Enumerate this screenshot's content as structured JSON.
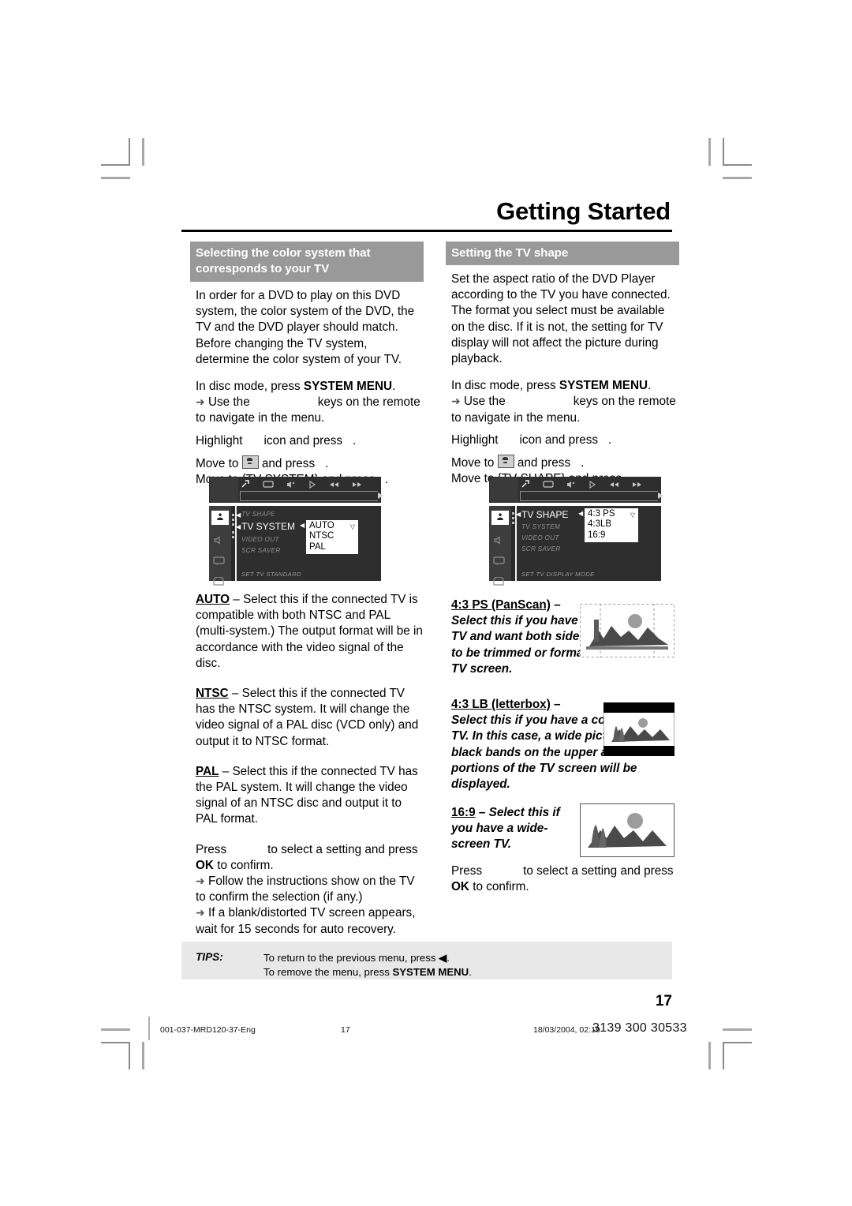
{
  "header": {
    "title": "Getting Started"
  },
  "left_column": {
    "section_title": "Selecting the color system that corresponds to your TV",
    "intro": "In order for a DVD to play on this DVD system, the color system of the DVD, the TV and the DVD player should match. Before changing the TV system, determine the color system of your TV.",
    "step_press_pre": "In disc mode, press ",
    "step_press_bold": "SYSTEM MENU",
    "step_press_post": ".",
    "use_keys_pre": "Use the",
    "use_keys_post": "keys on the remote to navigate in the menu.",
    "highlight_pre": "Highlight",
    "highlight_mid": "icon and press",
    "highlight_post": ".",
    "move_to_icon_pre": "Move to",
    "move_to_icon_post": "and press",
    "move_to_icon_end": ".",
    "move_to_menu": "Move to {TV SYSTEM} and press",
    "move_to_menu_end": ".",
    "options": [
      {
        "name": "AUTO",
        "text": " – Select this if the connected TV is compatible with both NTSC and PAL (multi-system.)  The output format will be in accordance with the video signal of the disc."
      },
      {
        "name": "NTSC",
        "text": " – Select this if the connected TV has the NTSC system. It will change the video signal of a PAL disc (VCD only) and output it to NTSC format."
      },
      {
        "name": "PAL",
        "text": " – Select this if the connected TV has the PAL system. It will change the video signal of an NTSC disc and output it to PAL format."
      }
    ],
    "press_pre": "Press",
    "press_mid": "to select a setting and press",
    "press_ok": "OK",
    "press_post": " to confirm.",
    "note1": "Follow the instructions show on the TV to confirm the selection (if any.)",
    "note2": "If a blank/distorted TV screen appears, wait for 15 seconds for auto recovery."
  },
  "right_column": {
    "section_title": "Setting the TV shape",
    "intro": "Set the aspect ratio of the DVD Player according to the TV you have connected. The format you select must be available on the disc.  If it is not, the setting for TV display will not affect the picture during playback.",
    "step_press_pre": "In disc mode, press ",
    "step_press_bold": "SYSTEM MENU",
    "step_press_post": ".",
    "use_keys_pre": "Use the",
    "use_keys_post": "keys on the remote to navigate in the menu.",
    "highlight_pre": "Highlight",
    "highlight_mid": "icon and press",
    "highlight_post": ".",
    "move_to_icon_pre": "Move to",
    "move_to_icon_post": "and press",
    "move_to_icon_end": ".",
    "move_to_menu": "Move to {TV SHAPE} and press",
    "move_to_menu_end": ".",
    "shapes": [
      {
        "name": "4:3 PS (PanScan)",
        "dash": " – ",
        "desc": "Select this if you have a conventional TV and want both sides of the picture to be trimmed or formatted to fit your TV screen."
      },
      {
        "name": "4:3 LB (letterbox)",
        "dash": " – ",
        "desc": "Select this if you have a conventional TV. In this case, a wide picture with black bands on the upper and lower portions of the TV screen will be displayed."
      },
      {
        "name": "16:9",
        "dash": " – ",
        "desc": "Select this if you have a wide-screen TV."
      }
    ],
    "press_pre": "Press",
    "press_mid": "to select a setting and press",
    "press_ok": "OK",
    "press_post": " to confirm."
  },
  "osd_left": {
    "rows": [
      "TV SHAPE",
      "TV SYSTEM",
      "VIDEO OUT",
      "SCR SAVER"
    ],
    "highlight_row": "TV SYSTEM",
    "footer": "SET TV STANDARD",
    "options": [
      "AUTO",
      "NTSC",
      "PAL"
    ],
    "selected": "AUTO"
  },
  "osd_right": {
    "rows": [
      "TV SHAPE",
      "TV SYSTEM",
      "VIDEO OUT",
      "SCR SAVER"
    ],
    "highlight_row": "TV SHAPE",
    "footer": "SET TV DISPLAY MODE",
    "options": [
      "4:3 PS",
      "4:3LB",
      "16:9"
    ],
    "selected": "4:3 PS"
  },
  "tips": {
    "label": "TIPS:",
    "line1_pre": "To return to the previous menu, press ",
    "line1_arrow": "◀",
    "line1_post": ".",
    "line2_pre": "To remove the menu, press ",
    "line2_bold": "SYSTEM MENU",
    "line2_post": "."
  },
  "page_number": "17",
  "footer": {
    "doc_id": "001-037-MRD120-37-Eng",
    "page": "17",
    "timestamp": "18/03/2004, 02:19",
    "code": "3139 300 30533"
  },
  "colors": {
    "section_bar": "#999999",
    "tips_bg": "#e8e8e8",
    "osd_bg": "#2a2a2a"
  }
}
